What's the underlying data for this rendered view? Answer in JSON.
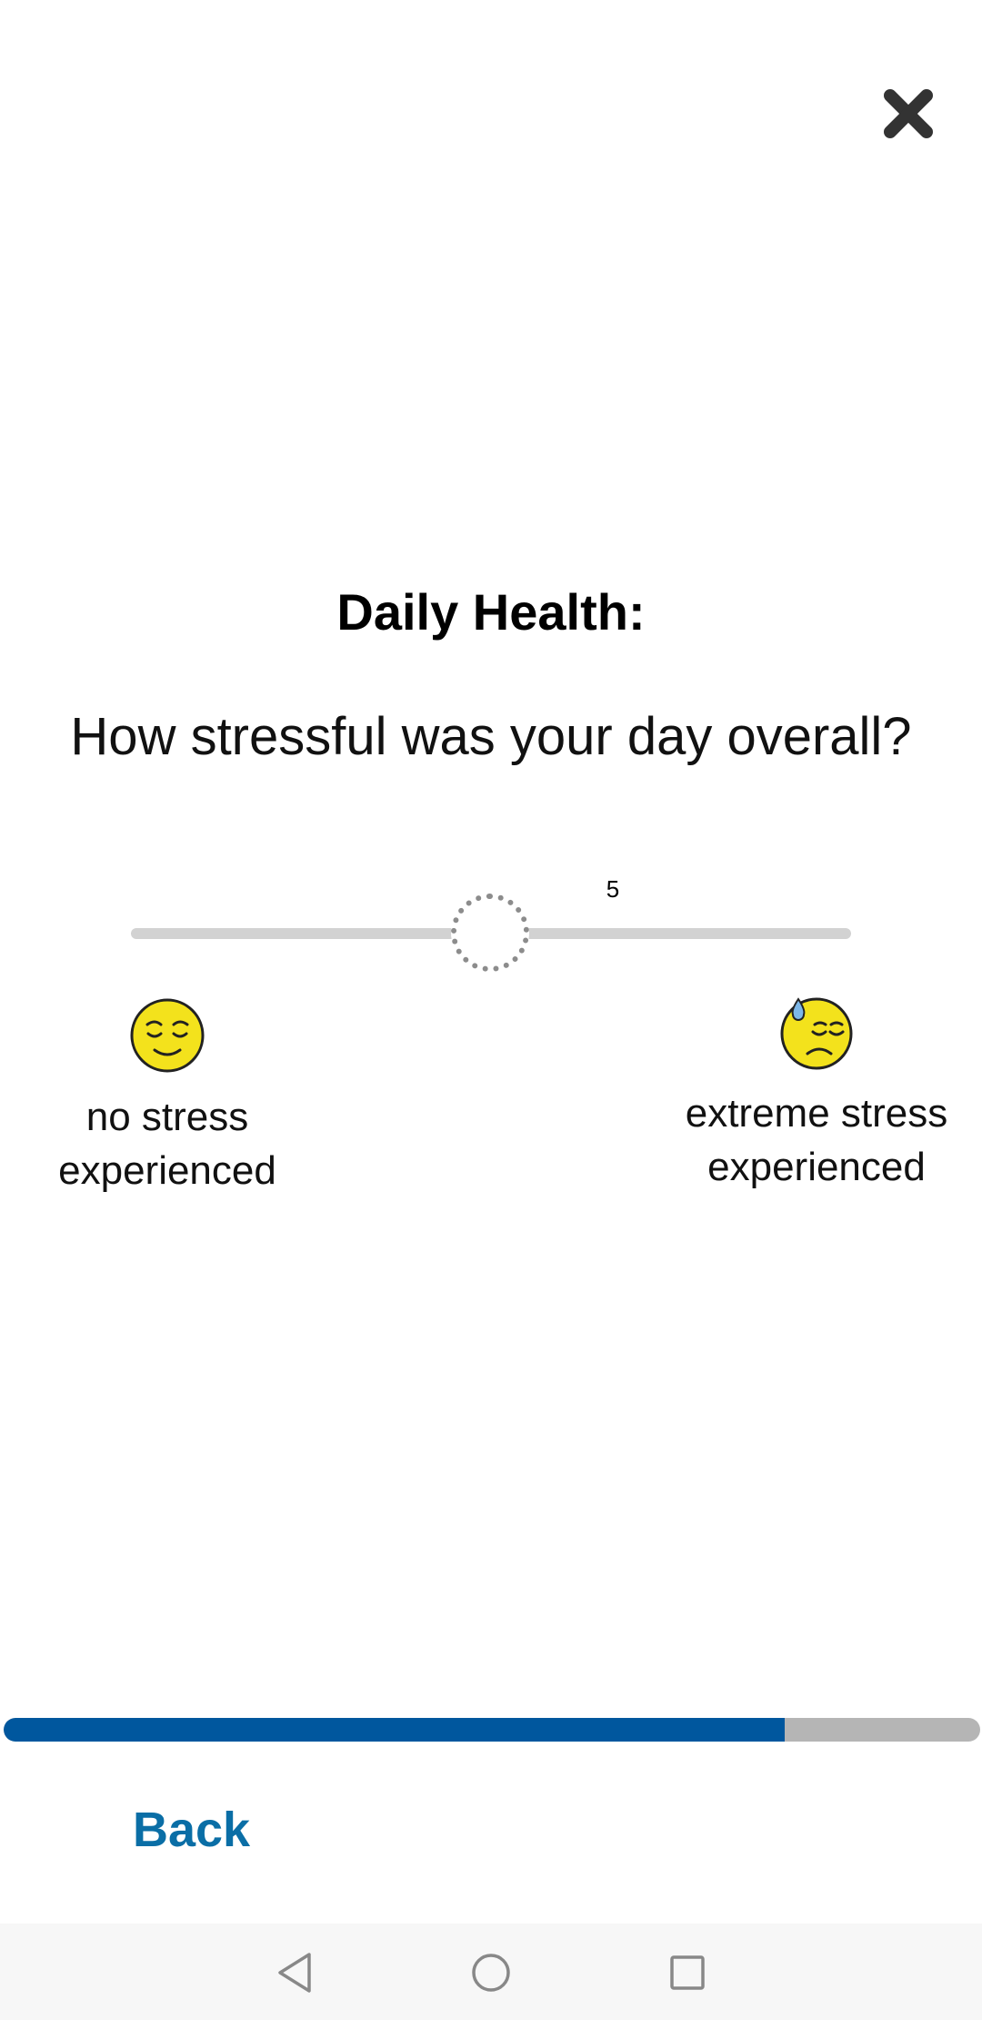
{
  "header": {
    "close_icon": "close-x-icon"
  },
  "survey": {
    "title": "Daily Health:",
    "question": "How stressful was your day overall?",
    "slider": {
      "value": "5",
      "min": 0,
      "max": 10
    },
    "min_anchor": {
      "icon": "relieved-face-icon",
      "label": "no stress experienced"
    },
    "max_anchor": {
      "icon": "downcast-face-with-sweat-icon",
      "label": "extreme stress experienced"
    }
  },
  "progress": {
    "fraction": 0.8,
    "fill_color": "#00579e",
    "track_color": "#b5b5b5"
  },
  "footer": {
    "back_label": "Back"
  },
  "nav_bar": {
    "icons": [
      "back-triangle-icon",
      "home-circle-icon",
      "recents-square-icon"
    ]
  },
  "colors": {
    "accent": "#0a6ea6",
    "emoji_yellow": "#f3e21c"
  }
}
